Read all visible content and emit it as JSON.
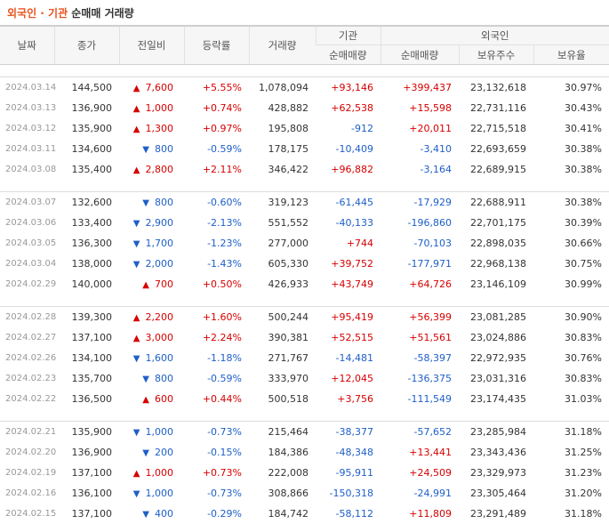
{
  "title": {
    "part1": "외국인 · 기관",
    "part2": " 순매매 거래량"
  },
  "headers": {
    "date": "날짜",
    "close": "종가",
    "diff": "전일비",
    "rate": "등락률",
    "volume": "거래량",
    "inst_group": "기관",
    "foreign_group": "외국인",
    "inst_net": "순매매량",
    "foreign_net": "순매매량",
    "holdings": "보유주수",
    "hold_ratio": "보유율"
  },
  "groups": [
    [
      {
        "date": "2024.03.14",
        "close": "144,500",
        "dir": "up",
        "diff": "7,600",
        "rate": "+5.55%",
        "volume": "1,078,094",
        "inst": "+93,146",
        "frn": "+399,437",
        "hold": "23,132,618",
        "ratio": "30.97%"
      },
      {
        "date": "2024.03.13",
        "close": "136,900",
        "dir": "up",
        "diff": "1,000",
        "rate": "+0.74%",
        "volume": "428,882",
        "inst": "+62,538",
        "frn": "+15,598",
        "hold": "22,731,116",
        "ratio": "30.43%"
      },
      {
        "date": "2024.03.12",
        "close": "135,900",
        "dir": "up",
        "diff": "1,300",
        "rate": "+0.97%",
        "volume": "195,808",
        "inst": "-912",
        "frn": "+20,011",
        "hold": "22,715,518",
        "ratio": "30.41%"
      },
      {
        "date": "2024.03.11",
        "close": "134,600",
        "dir": "dn",
        "diff": "800",
        "rate": "-0.59%",
        "volume": "178,175",
        "inst": "-10,409",
        "frn": "-3,410",
        "hold": "22,693,659",
        "ratio": "30.38%"
      },
      {
        "date": "2024.03.08",
        "close": "135,400",
        "dir": "up",
        "diff": "2,800",
        "rate": "+2.11%",
        "volume": "346,422",
        "inst": "+96,882",
        "frn": "-3,164",
        "hold": "22,689,915",
        "ratio": "30.38%"
      }
    ],
    [
      {
        "date": "2024.03.07",
        "close": "132,600",
        "dir": "dn",
        "diff": "800",
        "rate": "-0.60%",
        "volume": "319,123",
        "inst": "-61,445",
        "frn": "-17,929",
        "hold": "22,688,911",
        "ratio": "30.38%"
      },
      {
        "date": "2024.03.06",
        "close": "133,400",
        "dir": "dn",
        "diff": "2,900",
        "rate": "-2.13%",
        "volume": "551,552",
        "inst": "-40,133",
        "frn": "-196,860",
        "hold": "22,701,175",
        "ratio": "30.39%"
      },
      {
        "date": "2024.03.05",
        "close": "136,300",
        "dir": "dn",
        "diff": "1,700",
        "rate": "-1.23%",
        "volume": "277,000",
        "inst": "+744",
        "frn": "-70,103",
        "hold": "22,898,035",
        "ratio": "30.66%"
      },
      {
        "date": "2024.03.04",
        "close": "138,000",
        "dir": "dn",
        "diff": "2,000",
        "rate": "-1.43%",
        "volume": "605,330",
        "inst": "+39,752",
        "frn": "-177,971",
        "hold": "22,968,138",
        "ratio": "30.75%"
      },
      {
        "date": "2024.02.29",
        "close": "140,000",
        "dir": "up",
        "diff": "700",
        "rate": "+0.50%",
        "volume": "426,933",
        "inst": "+43,749",
        "frn": "+64,726",
        "hold": "23,146,109",
        "ratio": "30.99%"
      }
    ],
    [
      {
        "date": "2024.02.28",
        "close": "139,300",
        "dir": "up",
        "diff": "2,200",
        "rate": "+1.60%",
        "volume": "500,244",
        "inst": "+95,419",
        "frn": "+56,399",
        "hold": "23,081,285",
        "ratio": "30.90%"
      },
      {
        "date": "2024.02.27",
        "close": "137,100",
        "dir": "up",
        "diff": "3,000",
        "rate": "+2.24%",
        "volume": "390,381",
        "inst": "+52,515",
        "frn": "+51,561",
        "hold": "23,024,886",
        "ratio": "30.83%"
      },
      {
        "date": "2024.02.26",
        "close": "134,100",
        "dir": "dn",
        "diff": "1,600",
        "rate": "-1.18%",
        "volume": "271,767",
        "inst": "-14,481",
        "frn": "-58,397",
        "hold": "22,972,935",
        "ratio": "30.76%"
      },
      {
        "date": "2024.02.23",
        "close": "135,700",
        "dir": "dn",
        "diff": "800",
        "rate": "-0.59%",
        "volume": "333,970",
        "inst": "+12,045",
        "frn": "-136,375",
        "hold": "23,031,316",
        "ratio": "30.83%"
      },
      {
        "date": "2024.02.22",
        "close": "136,500",
        "dir": "up",
        "diff": "600",
        "rate": "+0.44%",
        "volume": "500,518",
        "inst": "+3,756",
        "frn": "-111,549",
        "hold": "23,174,435",
        "ratio": "31.03%"
      }
    ],
    [
      {
        "date": "2024.02.21",
        "close": "135,900",
        "dir": "dn",
        "diff": "1,000",
        "rate": "-0.73%",
        "volume": "215,464",
        "inst": "-38,377",
        "frn": "-57,652",
        "hold": "23,285,984",
        "ratio": "31.18%"
      },
      {
        "date": "2024.02.20",
        "close": "136,900",
        "dir": "dn",
        "diff": "200",
        "rate": "-0.15%",
        "volume": "184,386",
        "inst": "-48,348",
        "frn": "+13,441",
        "hold": "23,343,436",
        "ratio": "31.25%"
      },
      {
        "date": "2024.02.19",
        "close": "137,100",
        "dir": "up",
        "diff": "1,000",
        "rate": "+0.73%",
        "volume": "222,008",
        "inst": "-95,911",
        "frn": "+24,509",
        "hold": "23,329,973",
        "ratio": "31.23%"
      },
      {
        "date": "2024.02.16",
        "close": "136,100",
        "dir": "dn",
        "diff": "1,000",
        "rate": "-0.73%",
        "volume": "308,866",
        "inst": "-150,318",
        "frn": "-24,991",
        "hold": "23,305,464",
        "ratio": "31.20%"
      },
      {
        "date": "2024.02.15",
        "close": "137,100",
        "dir": "dn",
        "diff": "400",
        "rate": "-0.29%",
        "volume": "184,742",
        "inst": "-58,112",
        "frn": "+11,809",
        "hold": "23,291,489",
        "ratio": "31.18%"
      }
    ]
  ],
  "colors": {
    "up": "#d60000",
    "down": "#1e5fc8",
    "title_accent": "#e8541e"
  },
  "icons": {
    "up": "triangle-up-icon",
    "down": "triangle-down-icon"
  }
}
